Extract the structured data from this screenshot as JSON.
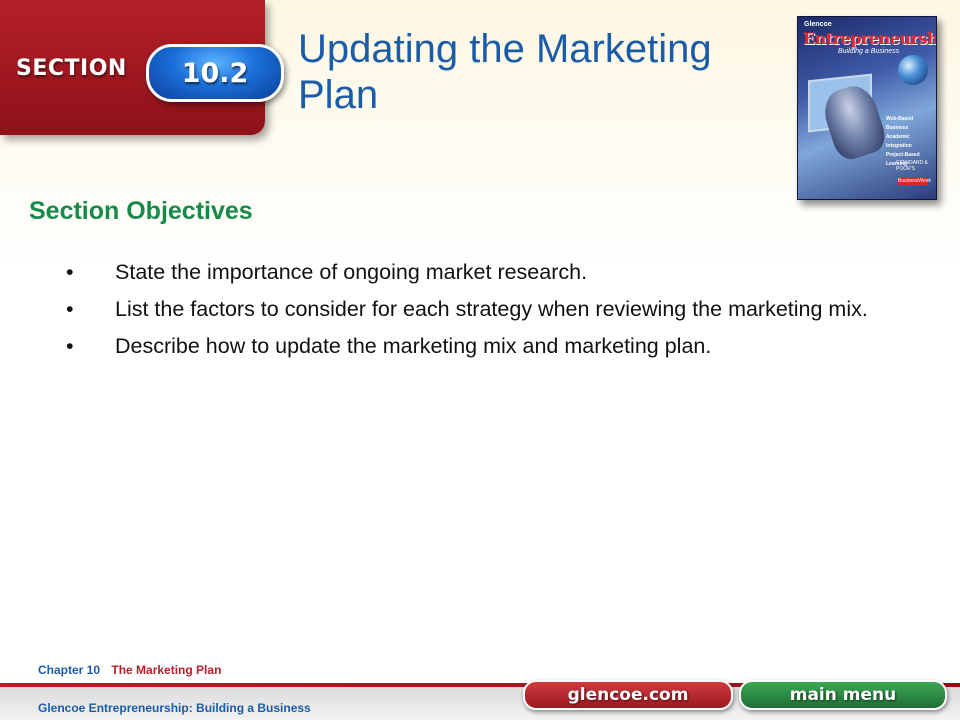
{
  "header": {
    "section_label": "SECTION",
    "section_number": "10.2",
    "title": "Updating the Marketing Plan"
  },
  "book": {
    "publisher": "Glencoe",
    "title": "Entrepreneurship",
    "subtitle": "Building a Business",
    "features": [
      "Web-Based Business",
      "Academic Integration",
      "Project-Based Learning"
    ],
    "partner": "STANDARD & POOR'S",
    "badge": "BusinessWeek"
  },
  "objectives": {
    "heading": "Section Objectives",
    "items": [
      "State the importance of ongoing market research.",
      "List the factors to consider for each strategy when reviewing the marketing mix.",
      "Describe how to update the marketing mix and marketing plan."
    ],
    "bullet": "•"
  },
  "footer": {
    "chapter_label": "Chapter 10",
    "chapter_name": "The Marketing Plan",
    "book_credit": "Glencoe Entrepreneurship: Building a Business",
    "glencoe_button": "glencoe.com",
    "menu_button": "main menu"
  },
  "colors": {
    "section_red": "#b5202a",
    "title_blue": "#1b5ca8",
    "heading_green": "#17894a",
    "menu_green": "#2c8a45"
  }
}
